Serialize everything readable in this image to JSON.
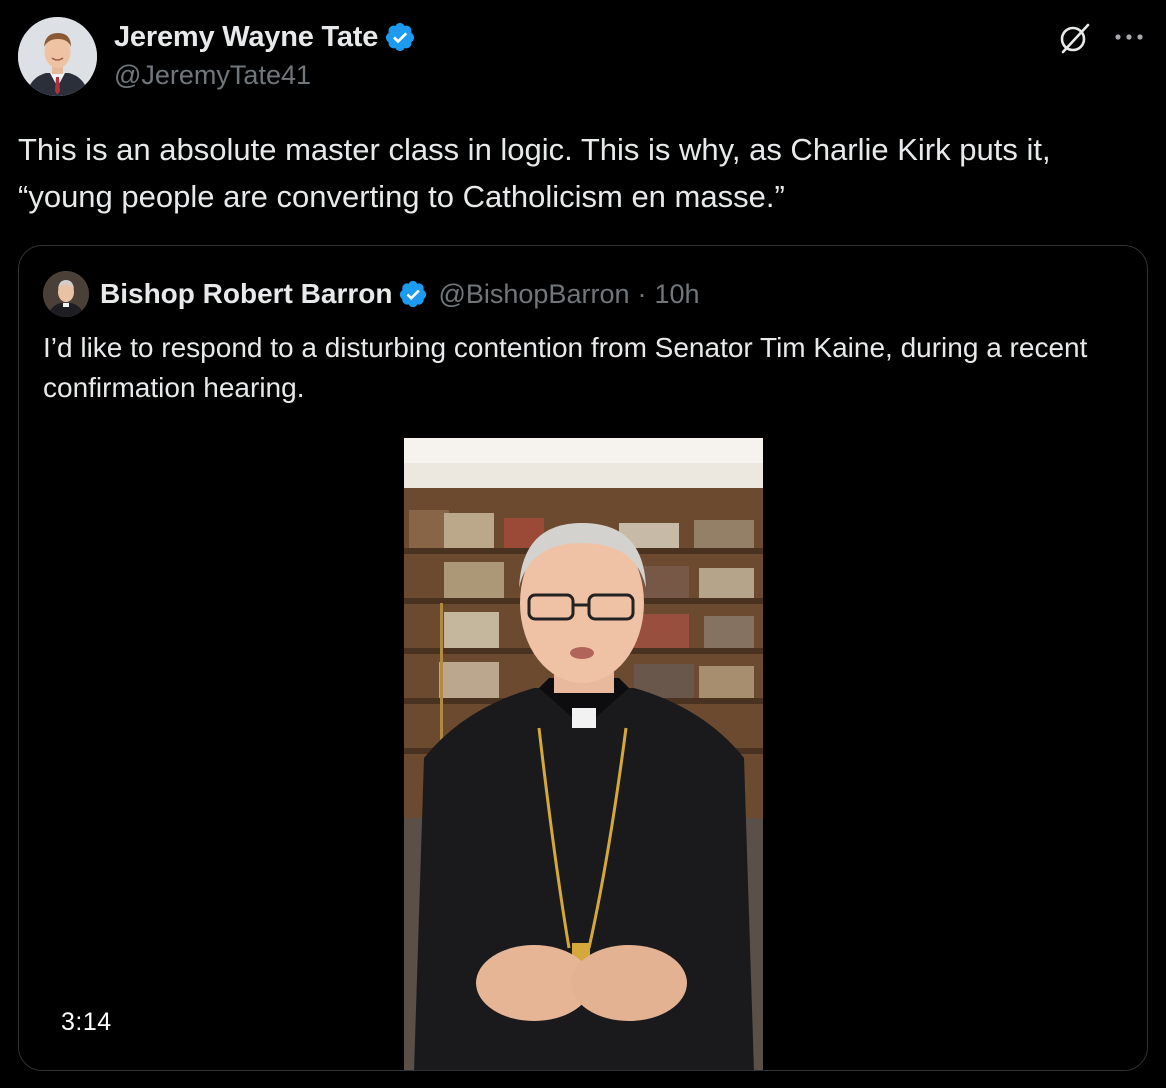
{
  "author": {
    "name": "Jeremy Wayne Tate",
    "handle": "@JeremyTate41",
    "verified": true
  },
  "tweet": {
    "text": "This is an absolute master class in logic. This is why, as Charlie Kirk puts it,\n“young people are converting to Catholicism en masse.”"
  },
  "header_icons": {
    "grok": "grok-icon",
    "more": "more-icon"
  },
  "quote": {
    "name": "Bishop Robert Barron",
    "handle": "@BishopBarron",
    "separator": "·",
    "time": "10h",
    "verified": true,
    "text": "I’d like to respond to a disturbing contention from Senator Tim Kaine, during a recent confirmation hearing.",
    "video": {
      "duration": "3:14"
    }
  },
  "colors": {
    "background": "#000000",
    "primary_text": "#e7e9ea",
    "secondary_text": "#71767b",
    "border": "#2f3336",
    "verified_blue": "#1d9bf0"
  }
}
